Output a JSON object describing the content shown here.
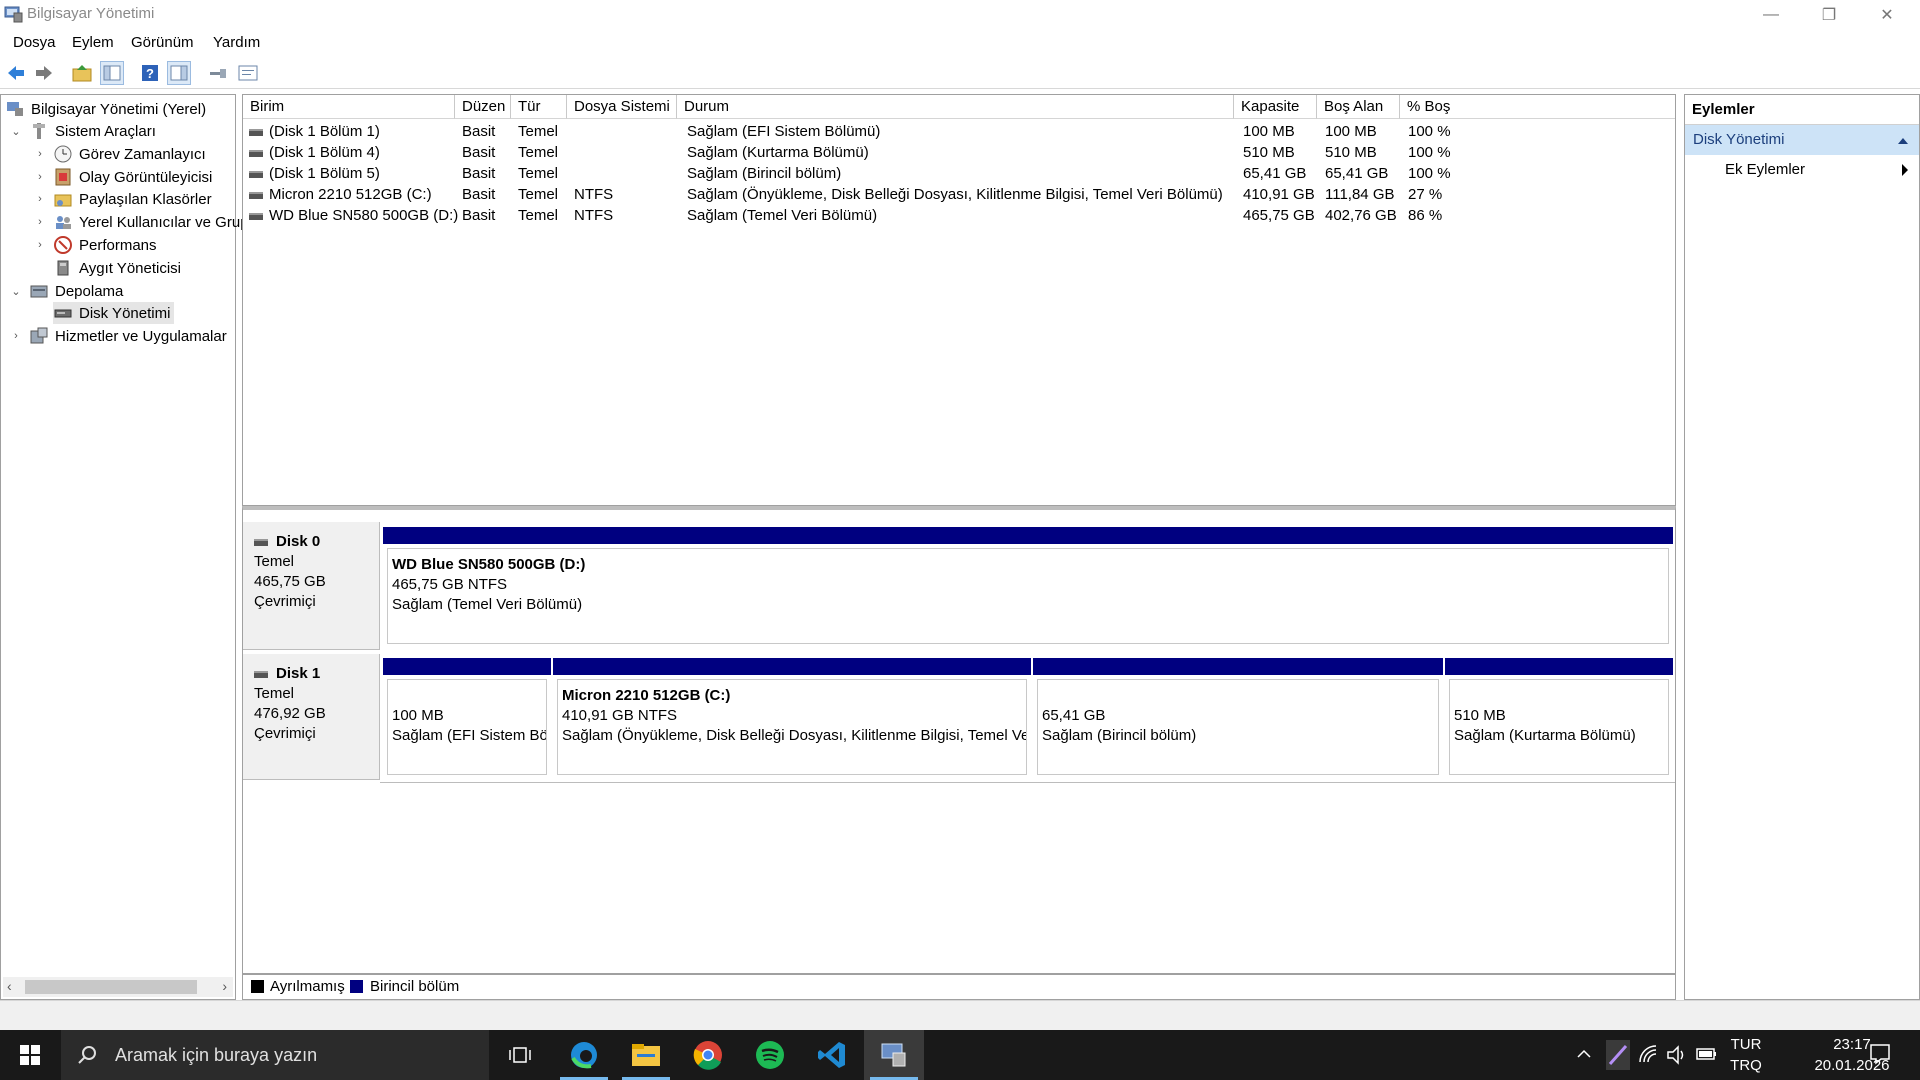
{
  "window": {
    "title": "Bilgisayar Yönetimi",
    "controls": {
      "minimize": "—",
      "restore": "❐",
      "close": "✕"
    }
  },
  "menu": [
    "Dosya",
    "Eylem",
    "Görünüm",
    "Yardım"
  ],
  "toolbar": {
    "icons": [
      "back-arrow-icon",
      "forward-arrow-icon",
      "up-folder-icon",
      "show-hide-tree-icon",
      "help-icon",
      "show-hide-action-pane-icon",
      "key-icon",
      "properties-icon"
    ]
  },
  "tree": {
    "root": "Bilgisayar Yönetimi (Yerel)",
    "system_tools": "Sistem Araçları",
    "task_scheduler": "Görev Zamanlayıcı",
    "event_viewer": "Olay Görüntüleyicisi",
    "shared_folders": "Paylaşılan Klasörler",
    "local_users": "Yerel Kullanıcılar ve Grup",
    "performance": "Performans",
    "device_manager": "Aygıt Yöneticisi",
    "storage": "Depolama",
    "disk_management": "Disk Yönetimi",
    "services": "Hizmetler ve Uygulamalar",
    "expand_open": "⌄",
    "expand_closed": "›",
    "scroll_left": "‹",
    "scroll_right": "›"
  },
  "table": {
    "columns": [
      "Birim",
      "Düzen",
      "Tür",
      "Dosya Sistemi",
      "Durum",
      "Kapasite",
      "Boş Alan",
      "% Boş"
    ],
    "rows": [
      [
        "(Disk 1 Bölüm 1)",
        "Basit",
        "Temel",
        "",
        "Sağlam (EFI Sistem Bölümü)",
        "100 MB",
        "100 MB",
        "100 %"
      ],
      [
        "(Disk 1 Bölüm 4)",
        "Basit",
        "Temel",
        "",
        "Sağlam (Kurtarma Bölümü)",
        "510 MB",
        "510 MB",
        "100 %"
      ],
      [
        "(Disk 1 Bölüm 5)",
        "Basit",
        "Temel",
        "",
        "Sağlam (Birincil bölüm)",
        "65,41 GB",
        "65,41 GB",
        "100 %"
      ],
      [
        "Micron 2210 512GB (C:)",
        "Basit",
        "Temel",
        "NTFS",
        "Sağlam (Önyükleme, Disk Belleği Dosyası, Kilitlenme Bilgisi, Temel Veri Bölümü)",
        "410,91 GB",
        "111,84 GB",
        "27 %"
      ],
      [
        "WD Blue SN580 500GB (D:)",
        "Basit",
        "Temel",
        "NTFS",
        "Sağlam (Temel Veri Bölümü)",
        "465,75 GB",
        "402,76 GB",
        "86 %"
      ]
    ]
  },
  "disks": {
    "disk0": {
      "name": "Disk 0",
      "type": "Temel",
      "size": "465,75 GB",
      "status": "Çevrimiçi",
      "p1": {
        "title": "WD Blue SN580 500GB  (D:)",
        "size": "465,75 GB NTFS",
        "status": "Sağlam (Temel Veri Bölümü)"
      }
    },
    "disk1": {
      "name": "Disk 1",
      "type": "Temel",
      "size": "476,92 GB",
      "status": "Çevrimiçi",
      "p1": {
        "size": "100 MB",
        "status": "Sağlam (EFI Sistem Bölümü)"
      },
      "p2": {
        "title": "Micron 2210 512GB  (C:)",
        "size": "410,91 GB NTFS",
        "status": "Sağlam (Önyükleme, Disk Belleği Dosyası, Kilitlenme Bilgisi, Temel Veri Bölümü)"
      },
      "p3": {
        "size": "65,41 GB",
        "status": "Sağlam (Birincil bölüm)"
      },
      "p4": {
        "size": "510 MB",
        "status": "Sağlam (Kurtarma Bölümü)"
      }
    }
  },
  "legend": {
    "unallocated": "Ayrılmamış",
    "primary": "Birincil bölüm",
    "unallocated_color": "#000000",
    "primary_color": "#000080"
  },
  "actions": {
    "header": "Eylemler",
    "selected": "Disk Yönetimi",
    "more": "Ek Eylemler"
  },
  "taskbar": {
    "search_placeholder": "Aramak için buraya yazın",
    "apps": [
      "task-view-icon",
      "edge-icon",
      "file-explorer-icon",
      "chrome-icon",
      "spotify-icon",
      "vscode-icon",
      "computer-management-icon"
    ],
    "lang_top": "TUR",
    "lang_bottom": "TRQ",
    "time": "23:17",
    "date": "20.01.2026"
  }
}
